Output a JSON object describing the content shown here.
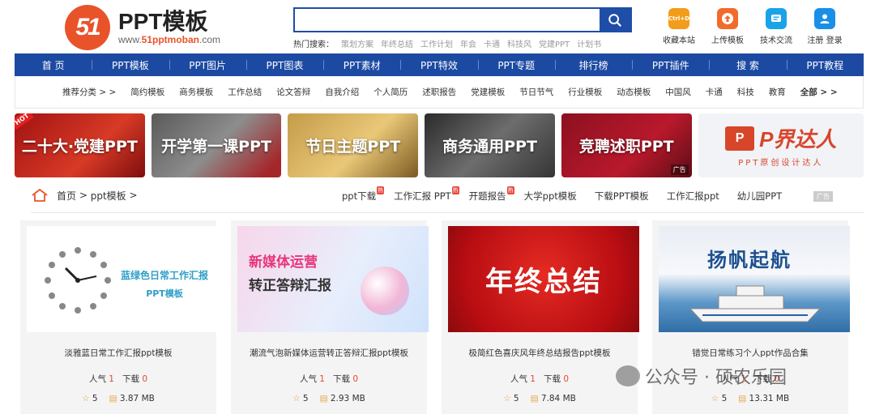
{
  "header": {
    "logo_number": "51",
    "logo_name": "PPT模板",
    "logo_url_prefix": "www.",
    "logo_url_brand": "51pptmoban",
    "logo_url_suffix": ".com",
    "search_placeholder": "",
    "hot_label": "热门搜索：",
    "hot_terms": [
      "策划方案",
      "年终总结",
      "工作计划",
      "年会",
      "卡通",
      "科技风",
      "党建PPT",
      "计划书"
    ],
    "tools": [
      {
        "label": "收藏本站",
        "icon": "ctrl-d-icon",
        "icon_text": "Ctrl+D",
        "color": "#f39c1b"
      },
      {
        "label": "上传模板",
        "icon": "upload-icon",
        "icon_text": "",
        "color": "#f26b2a"
      },
      {
        "label": "技术交流",
        "icon": "chat-icon",
        "icon_text": "",
        "color": "#1aa3e8"
      },
      {
        "label": "注册 登录",
        "icon": "user-icon",
        "icon_text": "",
        "color": "#1a8fe8"
      }
    ]
  },
  "nav": [
    "首 页",
    "PPT模板",
    "PPT图片",
    "PPT图表",
    "PPT素材",
    "PPT特效",
    "PPT专题",
    "排行榜",
    "PPT插件",
    "搜 索",
    "PPT教程"
  ],
  "categories": [
    "推荐分类 > >",
    "简约模板",
    "商务模板",
    "工作总结",
    "论文答辩",
    "自我介绍",
    "个人简历",
    "述职报告",
    "党建模板",
    "节日节气",
    "行业模板",
    "动态模板",
    "中国风",
    "卡通",
    "科技",
    "教育",
    "全部 > >"
  ],
  "banners": [
    {
      "title": "二十大·党建PPT",
      "hot": "HOT",
      "ad": ""
    },
    {
      "title": "开学第一课PPT",
      "hot": "",
      "ad": ""
    },
    {
      "title": "节日主题PPT",
      "hot": "",
      "ad": ""
    },
    {
      "title": "商务通用PPT",
      "hot": "",
      "ad": ""
    },
    {
      "title": "竞聘述职PPT",
      "hot": "",
      "ad": "广告"
    }
  ],
  "promo": {
    "logo": "P",
    "name": "P界达人",
    "sub": "PPT原创设计达人"
  },
  "breadcrumb": {
    "home": "首页",
    "sep": ">",
    "current": "ppt模板",
    "tail": ">"
  },
  "quick_links": [
    {
      "label": "ppt下载",
      "tag": "热"
    },
    {
      "label": "工作汇报 PPT",
      "tag": "热"
    },
    {
      "label": "开题报告",
      "tag": "热"
    },
    {
      "label": "大学ppt模板",
      "tag": ""
    },
    {
      "label": "下载PPT模板",
      "tag": ""
    },
    {
      "label": "工作汇报ppt",
      "tag": ""
    },
    {
      "label": "幼儿园PPT",
      "tag": ""
    }
  ],
  "quick_ad": "广告",
  "cards": [
    {
      "thumb_title": "蓝绿色日常工作汇报",
      "thumb_sub": "PPT模板",
      "title": "淡雅蓝日常工作汇报ppt模板",
      "popularity_label": "人气",
      "popularity": "1",
      "downloads_label": "下载",
      "downloads": "0",
      "rating": "5",
      "size": "3.87 MB"
    },
    {
      "thumb_title": "新媒体运营",
      "thumb_sub": "转正答辩汇报",
      "title": "潮流气泡新媒体运营转正答辩汇报ppt模板",
      "popularity_label": "人气",
      "popularity": "1",
      "downloads_label": "下载",
      "downloads": "0",
      "rating": "5",
      "size": "2.93 MB"
    },
    {
      "thumb_title": "年终总结",
      "thumb_sub": "",
      "title": "极简红色喜庆风年终总结报告ppt模板",
      "popularity_label": "人气",
      "popularity": "1",
      "downloads_label": "下载",
      "downloads": "0",
      "rating": "5",
      "size": "7.84 MB"
    },
    {
      "thumb_title": "扬帆起航",
      "thumb_sub": "",
      "title": "错觉日常练习个人ppt作品合集",
      "popularity_label": "人气",
      "popularity": "1",
      "downloads_label": "下载",
      "downloads": "0",
      "rating": "5",
      "size": "13.31 MB"
    }
  ],
  "watermark": "公众号 · 硕农乐园",
  "colors": {
    "brand_blue": "#1c4aa2",
    "accent_red": "#e24a33",
    "logo_orange": "#e9532a"
  }
}
